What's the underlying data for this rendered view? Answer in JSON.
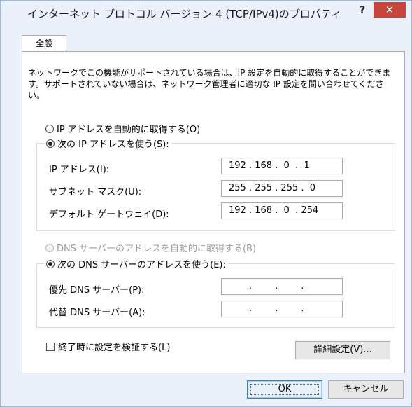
{
  "window": {
    "title": "インターネット プロトコル バージョン 4 (TCP/IPv4)のプロパティ",
    "help_label": "?",
    "close_label": "✕"
  },
  "tabs": [
    {
      "label": "全般"
    }
  ],
  "description": "ネットワークでこの機能がサポートされている場合は、IP 設定を自動的に取得することができます。サポートされていない場合は、ネットワーク管理者に適切な IP 設定を問い合わせてください。",
  "ip_section": {
    "auto_label": "IP アドレスを自動的に取得する(O)",
    "auto_selected": false,
    "manual_label": "次の IP アドレスを使う(S):",
    "manual_selected": true,
    "fields": [
      {
        "label": "IP アドレス(I):",
        "value": "192 . 168 .  0  .  1"
      },
      {
        "label": "サブネット マスク(U):",
        "value": "255 . 255 . 255 .  0"
      },
      {
        "label": "デフォルト ゲートウェイ(D):",
        "value": "192 . 168 .  0  . 254"
      }
    ]
  },
  "dns_section": {
    "auto_label": "DNS サーバーのアドレスを自動的に取得する(B)",
    "auto_disabled": true,
    "manual_label": "次の DNS サーバーのアドレスを使う(E):",
    "manual_selected": true,
    "fields": [
      {
        "label": "優先 DNS サーバー(P):",
        "value": "       .        .        ."
      },
      {
        "label": "代替 DNS サーバー(A):",
        "value": "       .        .        ."
      }
    ]
  },
  "validate_checkbox": {
    "label": "終了時に設定を検証する(L)",
    "checked": false
  },
  "buttons": {
    "advanced": "詳細設定(V)...",
    "ok": "OK",
    "cancel": "キャンセル"
  },
  "colors": {
    "window_bg": "#eaf1fb",
    "close_button": "#c7463c",
    "default_button_border": "#3c7fb1"
  }
}
